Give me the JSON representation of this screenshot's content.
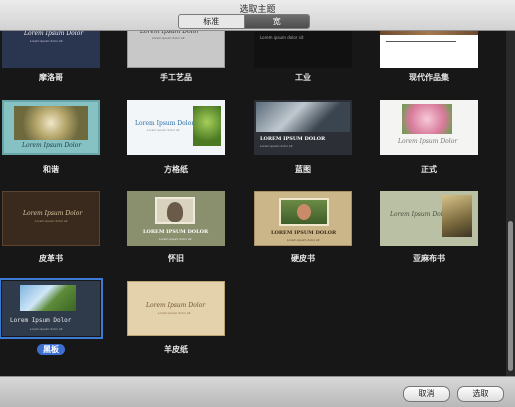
{
  "window": {
    "title": "选取主题"
  },
  "segmented": {
    "options": [
      "标准",
      "宽"
    ],
    "selected": "宽"
  },
  "tile_text": {
    "lorem": "Lorem Ipsum Dolor",
    "lorem_caps": "LOREM IPSUM DOLOR",
    "sub": "Lorem ipsum dolor sit"
  },
  "themes": [
    {
      "label": "摩洛哥"
    },
    {
      "label": "手工艺品"
    },
    {
      "label": "工业"
    },
    {
      "label": "现代作品集"
    },
    {
      "label": "和谐"
    },
    {
      "label": "方格纸"
    },
    {
      "label": "蓝图"
    },
    {
      "label": "正式"
    },
    {
      "label": "皮革书"
    },
    {
      "label": "怀旧"
    },
    {
      "label": "硬皮书"
    },
    {
      "label": "亚麻布书"
    },
    {
      "label": "黑板",
      "selected": true
    },
    {
      "label": "羊皮纸"
    }
  ],
  "buttons": {
    "cancel": "取消",
    "choose": "选取"
  }
}
